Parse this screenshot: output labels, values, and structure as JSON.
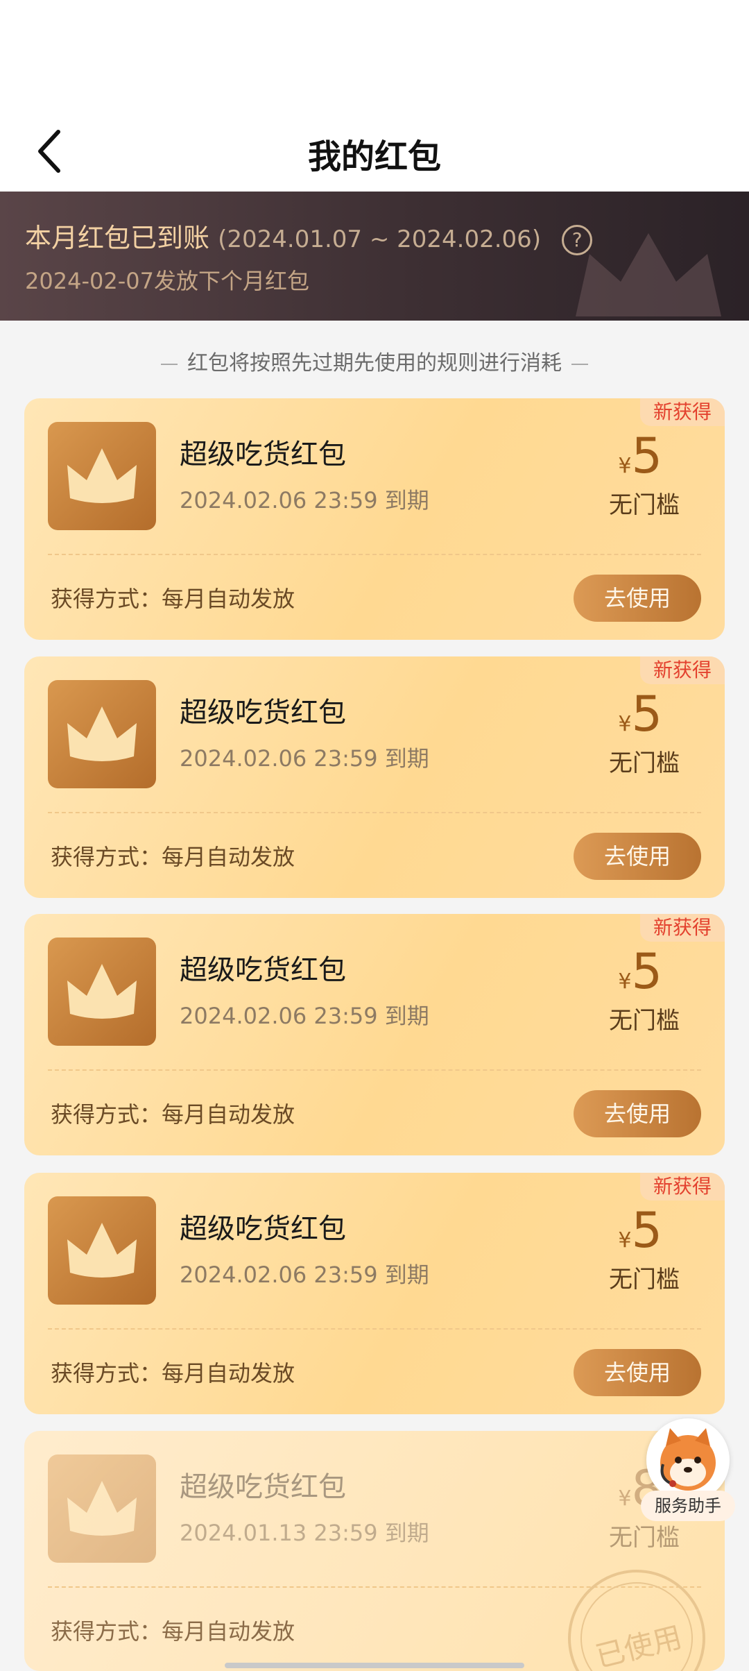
{
  "header": {
    "title": "我的红包",
    "back_icon": "chevron-left-icon"
  },
  "banner": {
    "title": "本月红包已到账",
    "range": "(2024.01.07 ~ 2024.02.06)",
    "help_icon_glyph": "?",
    "next_release": "2024-02-07发放下个月红包"
  },
  "rule_text": "红包将按照先过期先使用的规则进行消耗",
  "coupons": [
    {
      "badge": "新获得",
      "name": "超级吃货红包",
      "expire": "2024.02.06 23:59 到期",
      "currency": "¥",
      "amount": "5",
      "threshold": "无门槛",
      "source": "获得方式：每月自动发放",
      "button": "去使用"
    },
    {
      "badge": "新获得",
      "name": "超级吃货红包",
      "expire": "2024.02.06 23:59 到期",
      "currency": "¥",
      "amount": "5",
      "threshold": "无门槛",
      "source": "获得方式：每月自动发放",
      "button": "去使用"
    },
    {
      "badge": "新获得",
      "name": "超级吃货红包",
      "expire": "2024.02.06 23:59 到期",
      "currency": "¥",
      "amount": "5",
      "threshold": "无门槛",
      "source": "获得方式：每月自动发放",
      "button": "去使用"
    },
    {
      "badge": "新获得",
      "name": "超级吃货红包",
      "expire": "2024.02.06 23:59 到期",
      "currency": "¥",
      "amount": "5",
      "threshold": "无门槛",
      "source": "获得方式：每月自动发放",
      "button": "去使用"
    },
    {
      "name": "超级吃货红包",
      "expire": "2024.01.13 23:59 到期",
      "currency": "¥",
      "amount": "8",
      "threshold": "无门槛",
      "source": "获得方式：每月自动发放",
      "stamp": "已使用"
    }
  ],
  "helper": {
    "label": "服务助手",
    "avatar_icon": "shiba-dog-icon"
  },
  "colors": {
    "accent": "#b97331",
    "badge_red": "#e3412e",
    "card_bg": "#ffd992"
  }
}
